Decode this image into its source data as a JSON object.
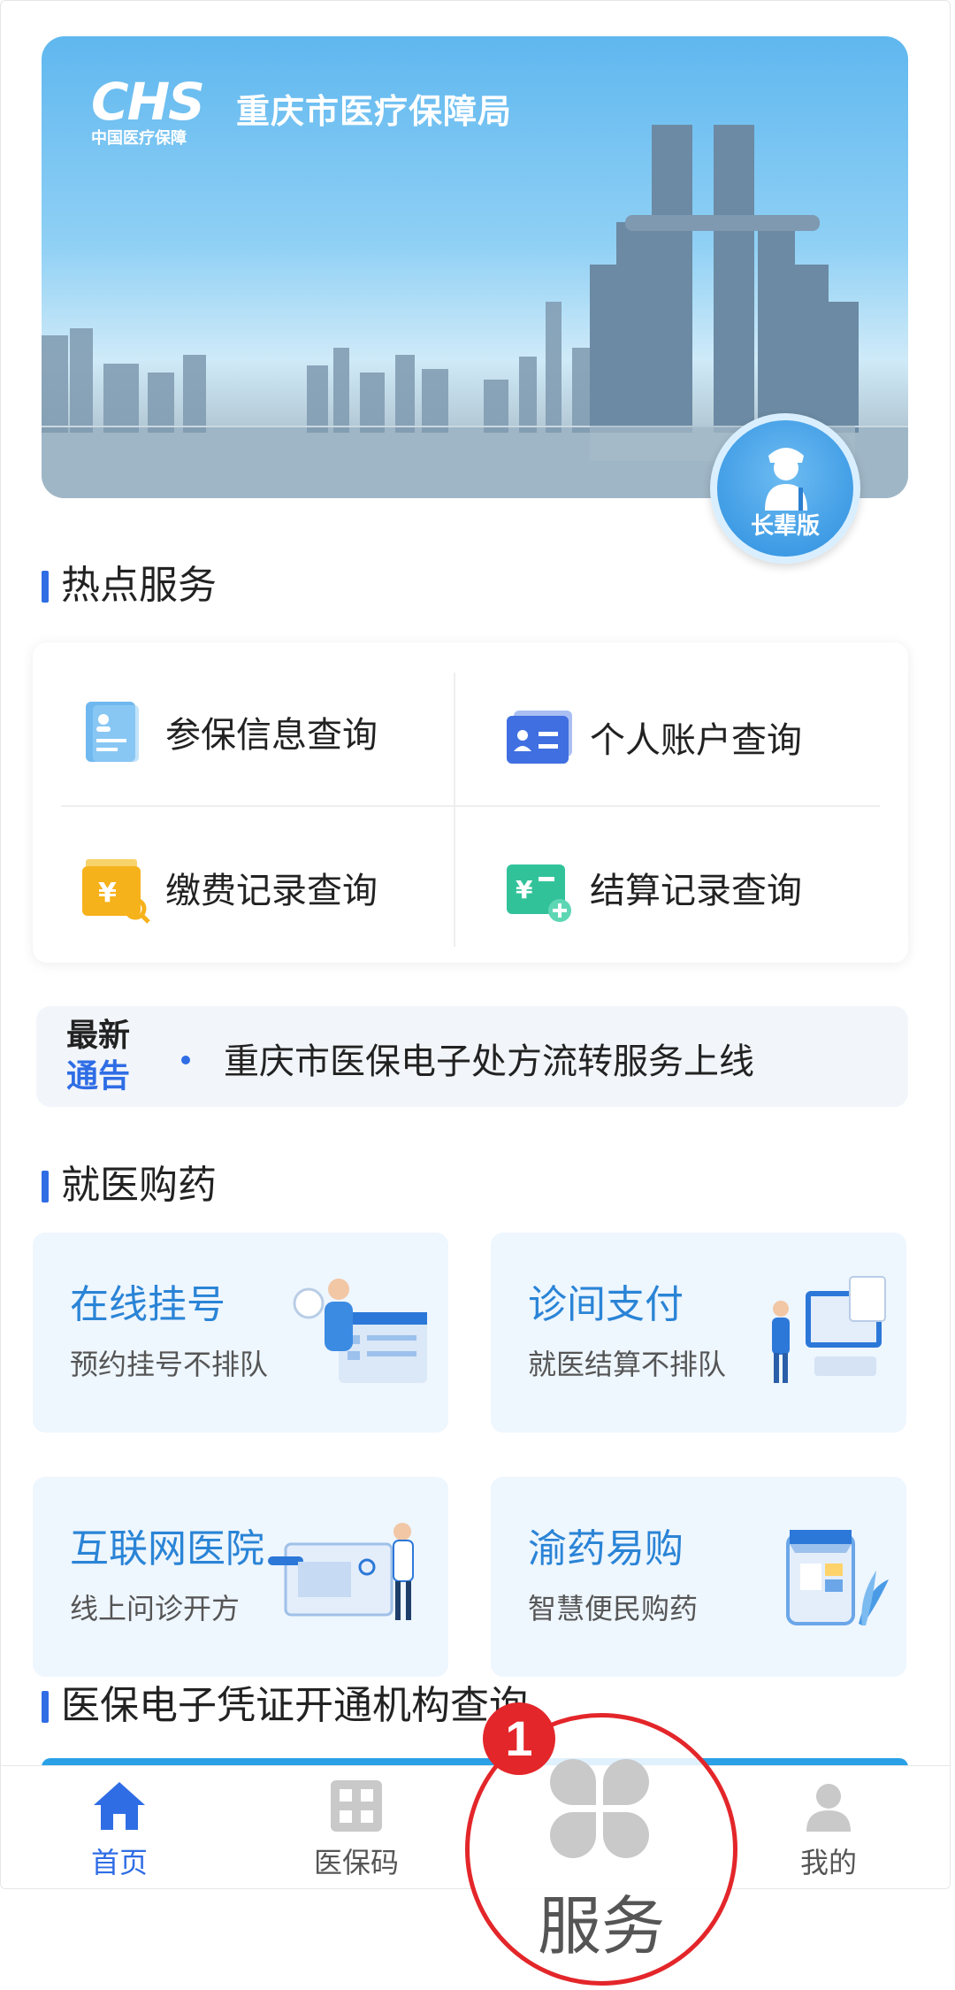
{
  "banner": {
    "logo_mark": "CHS",
    "logo_sub": "中国医疗保障",
    "title": "重庆市医疗保障局",
    "elder_mode_label": "长辈版"
  },
  "hot_services": {
    "title": "热点服务",
    "items": [
      {
        "label": "参保信息查询",
        "icon": "insurance-info-icon"
      },
      {
        "label": "个人账户查询",
        "icon": "id-card-icon"
      },
      {
        "label": "缴费记录查询",
        "icon": "payment-search-icon"
      },
      {
        "label": "结算记录查询",
        "icon": "settlement-add-icon"
      }
    ]
  },
  "notice": {
    "tag_line1": "最新",
    "tag_line2": "通告",
    "text": "重庆市医保电子处方流转服务上线"
  },
  "medical": {
    "title": "就医购药",
    "cards": [
      {
        "title": "在线挂号",
        "subtitle": "预约挂号不排队"
      },
      {
        "title": "诊间支付",
        "subtitle": "就医结算不排队"
      },
      {
        "title": "互联网医院",
        "subtitle": "线上问诊开方"
      },
      {
        "title": "渝药易购",
        "subtitle": "智慧便民购药"
      }
    ]
  },
  "ecert": {
    "title": "医保电子凭证开通机构查询"
  },
  "tabbar": {
    "items": [
      {
        "label": "首页",
        "icon": "home-icon",
        "active": true
      },
      {
        "label": "医保码",
        "icon": "qr-code-icon",
        "active": false
      },
      {
        "label": "服务",
        "icon": "clover-grid-icon",
        "active": false
      },
      {
        "label": "我的",
        "icon": "user-icon",
        "active": false
      }
    ]
  },
  "annotation": {
    "step_number": "1",
    "highlight_color": "#e3262a"
  },
  "colors": {
    "accent": "#2f6de5",
    "card_title": "#2a84d6"
  }
}
